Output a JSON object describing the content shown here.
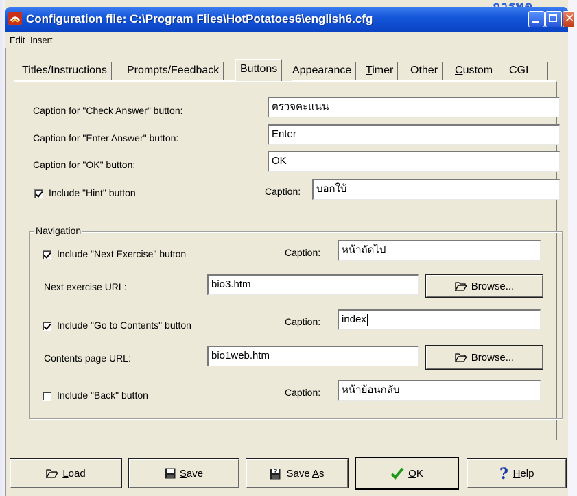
{
  "window": {
    "title": "Configuration file: C:\\Program Files\\HotPotatoes6\\english6.cfg",
    "bg_fragment": "การทด"
  },
  "menu": [
    "Edit",
    "Insert"
  ],
  "tabs": [
    {
      "label": "Titles/Instructions",
      "active": false
    },
    {
      "label": "Prompts/Feedback",
      "active": false
    },
    {
      "label": "Buttons",
      "active": true
    },
    {
      "label": "Appearance",
      "active": false
    },
    {
      "label": "Timer",
      "underline": "T",
      "active": false
    },
    {
      "label": "Other",
      "active": false
    },
    {
      "label": "Custom",
      "underline": "C",
      "active": false
    },
    {
      "label": "CGI",
      "active": false
    }
  ],
  "buttons_tab": {
    "check_label": "Caption for \"Check Answer\" button:",
    "check_value": "ตรวจคะแนน",
    "enter_label": "Caption for \"Enter Answer\" button:",
    "enter_value": "Enter",
    "ok_label": "Caption for \"OK\" button:",
    "ok_value": "OK",
    "hint_label": "Include \"Hint\" button",
    "hint_checked": true,
    "caption_label": "Caption:",
    "hint_caption": "บอกใบ้"
  },
  "navigation": {
    "legend": "Navigation",
    "next_label": "Include \"Next Exercise\" button",
    "next_checked": true,
    "next_caption": "หน้าถัดไป",
    "next_url_label": "Next exercise URL:",
    "next_url": "bio3.htm",
    "contents_label": "Include \"Go to Contents\" button",
    "contents_checked": true,
    "contents_caption": "index",
    "contents_url_label": "Contents page URL:",
    "contents_url": "bio1web.htm",
    "back_label": "Include \"Back\" button",
    "back_checked": false,
    "back_caption": "หน้าย้อนกลับ",
    "browse_label": "Browse...",
    "caption_label": "Caption:"
  },
  "footer": {
    "load": {
      "label": "Load",
      "underline": "L"
    },
    "save": {
      "label": "Save",
      "underline": "S"
    },
    "save_as": {
      "label": "Save As",
      "underline": "A"
    },
    "ok": {
      "label": "OK",
      "underline": "O"
    },
    "help": {
      "label": "Help",
      "underline": "H"
    }
  },
  "colors": {
    "titlebar": "#0a44c4",
    "ok_check": "#1a9a1a",
    "help_q": "#1a3aa8",
    "app_icon_red": "#c8301a"
  }
}
